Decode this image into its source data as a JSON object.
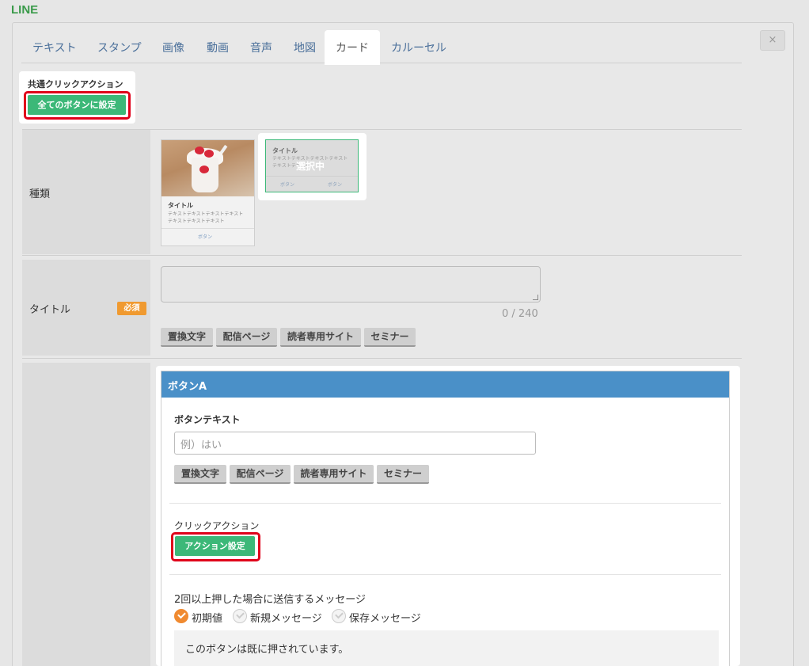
{
  "brand": "LINE",
  "close_symbol": "×",
  "tabs": [
    "テキスト",
    "スタンプ",
    "画像",
    "動画",
    "音声",
    "地図",
    "カード",
    "カルーセル"
  ],
  "active_tab": "カード",
  "common_action": {
    "title": "共通クリックアクション",
    "button": "全てのボタンに設定"
  },
  "type_row": {
    "label": "種類",
    "card1": {
      "title": "タイトル",
      "text": "テキストテキストテキストテキストテキストテキストテキスト",
      "button": "ボタン"
    },
    "card2": {
      "title": "タイトル",
      "text": "テキストテキストテキストテキストテキストテキスト",
      "button_left": "ボタン",
      "button_right": "ボタン",
      "selected_label": "選択中"
    }
  },
  "title_row": {
    "label": "タイトル",
    "required_badge": "必須",
    "counter": "0 / 240",
    "insert_buttons": [
      "置換文字",
      "配信ページ",
      "読者専用サイト",
      "セミナー"
    ]
  },
  "button_a": {
    "header": "ボタンA",
    "text_label": "ボタンテキスト",
    "text_placeholder": "例）はい",
    "insert_buttons": [
      "置換文字",
      "配信ページ",
      "読者専用サイト",
      "セミナー"
    ],
    "click_action_label": "クリックアクション",
    "action_button": "アクション設定",
    "repeat_label": "2回以上押した場合に送信するメッセージ",
    "options": [
      "初期値",
      "新規メッセージ",
      "保存メッセージ"
    ],
    "selected_option": "初期値",
    "message": "このボタンは既に押されています。"
  },
  "colors": {
    "accent_green": "#3cb878",
    "header_blue": "#4a90c8",
    "highlight_red": "#e0001a",
    "required_orange": "#f09a30"
  }
}
